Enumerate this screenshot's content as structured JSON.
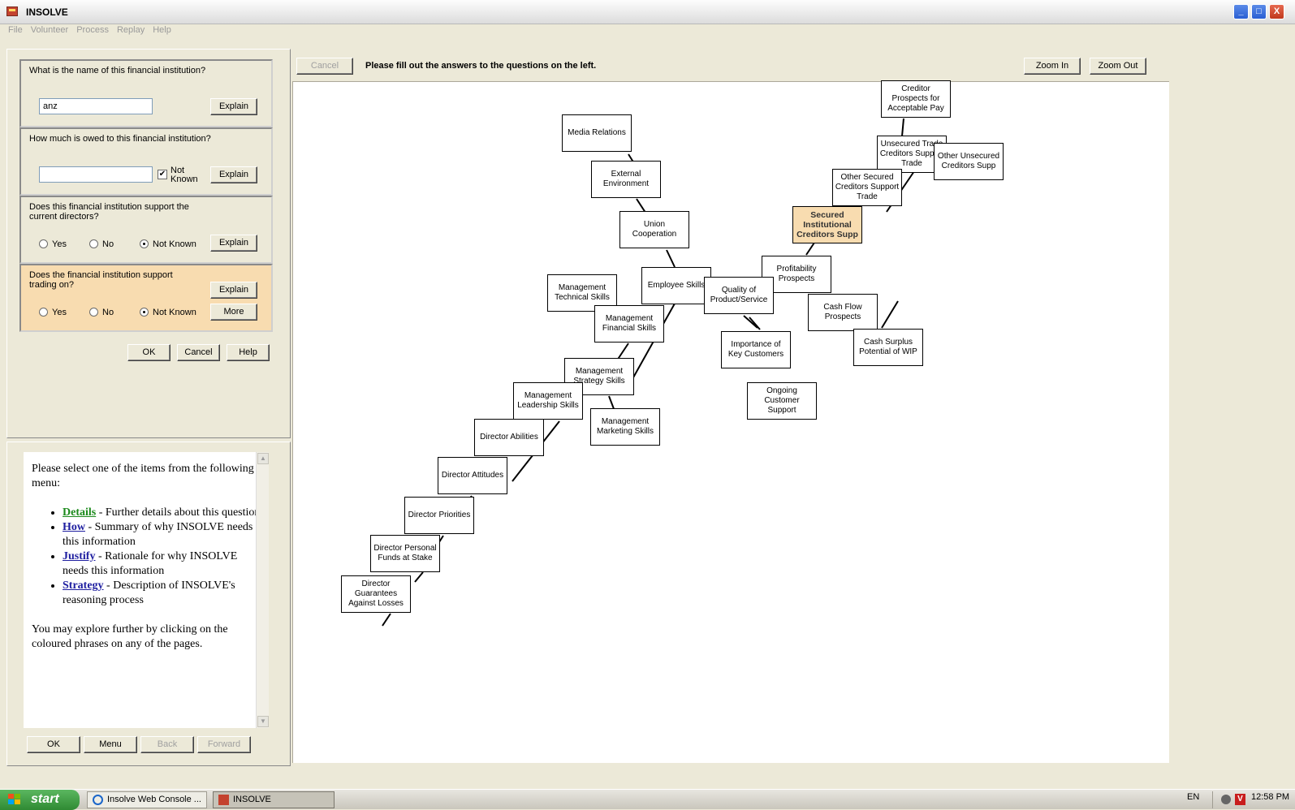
{
  "window": {
    "title": "INSOLVE",
    "buttons": [
      "_",
      "□",
      "X"
    ]
  },
  "menu": [
    "File",
    "Volunteer",
    "Process",
    "Replay",
    "Help"
  ],
  "questions": {
    "q1": {
      "text": "What is the name of this financial institution?",
      "value": "anz",
      "explain": "Explain"
    },
    "q2": {
      "text": "How much is owed to this financial institution?",
      "value": "",
      "checkbox_label": "Not Known",
      "checkbox_checked": true,
      "explain": "Explain"
    },
    "q3": {
      "text": "Does this financial institution support the current directors?",
      "options": [
        "Yes",
        "No",
        "Not Known"
      ],
      "selected": "Not Known",
      "explain": "Explain"
    },
    "q4": {
      "text": "Does the financial institution support trading on?",
      "options": [
        "Yes",
        "No",
        "Not Known"
      ],
      "selected": "Not Known",
      "explain": "Explain",
      "more": "More"
    }
  },
  "dialog_buttons": {
    "ok": "OK",
    "cancel": "Cancel",
    "help": "Help"
  },
  "help": {
    "intro": "Please select one of the items from the following menu:",
    "items": [
      {
        "link": "Details",
        "text": " - Further details about this question"
      },
      {
        "link": "How",
        "text": " - Summary of why INSOLVE needs this information"
      },
      {
        "link": "Justify",
        "text": " - Rationale for why INSOLVE needs this information"
      },
      {
        "link": "Strategy",
        "text": " - Description of INSOLVE's reasoning process"
      }
    ],
    "outro": "You may explore further by clicking on the coloured phrases on any of the pages.",
    "nav": {
      "ok": "OK",
      "menu": "Menu",
      "back": "Back",
      "forward": "Forward"
    }
  },
  "graph": {
    "cancel_label": "Cancel",
    "instruction": "Please fill out the answers to the questions on the left.",
    "zoom_in": "Zoom In",
    "zoom_out": "Zoom Out",
    "nodes": {
      "creditor_prospects": "Creditor Prospects for Acceptable Pay",
      "media_relations": "Media Relations",
      "external_environment": "External Environment",
      "union_cooperation": "Union Cooperation",
      "employee_skills": "Employee Skills",
      "mgmt_technical": "Management Technical Skills",
      "mgmt_financial": "Management Financial Skills",
      "mgmt_strategy": "Management Strategy Skills",
      "mgmt_leadership": "Management Leadership Skills",
      "mgmt_marketing": "Management Marketing Skills",
      "director_abilities": "Director Abilities",
      "director_attitudes": "Director Attitudes",
      "director_priorities": "Director Priorities",
      "director_funds": "Director Personal Funds at Stake",
      "director_guarantees": "Director Guarantees Against Losses",
      "unsecured_trade": "Unsecured Trade Creditors Support Trade",
      "other_unsecured": "Other Unsecured Creditors Supp",
      "other_secured": "Other Secured Creditors Support Trade",
      "secured_institutional": "Secured Institutional Creditors Supp",
      "profitability": "Profitability Prospects",
      "quality": "Quality of Product/Service",
      "cash_flow": "Cash Flow Prospects",
      "cash_surplus": "Cash Surplus Potential of WIP",
      "importance_customers": "Importance of Key Customers",
      "ongoing_support": "Ongoing Customer Support"
    }
  },
  "taskbar": {
    "start": "start",
    "tasks": [
      "Insolve Web Console ...",
      "INSOLVE"
    ],
    "lang": "EN",
    "time": "12:58 PM"
  },
  "colors": {
    "selected_node": "#f8dcb0",
    "active_question": "#f8dcb0",
    "link_green": "#1c8a1c",
    "link_blue": "#1e1ea0"
  }
}
